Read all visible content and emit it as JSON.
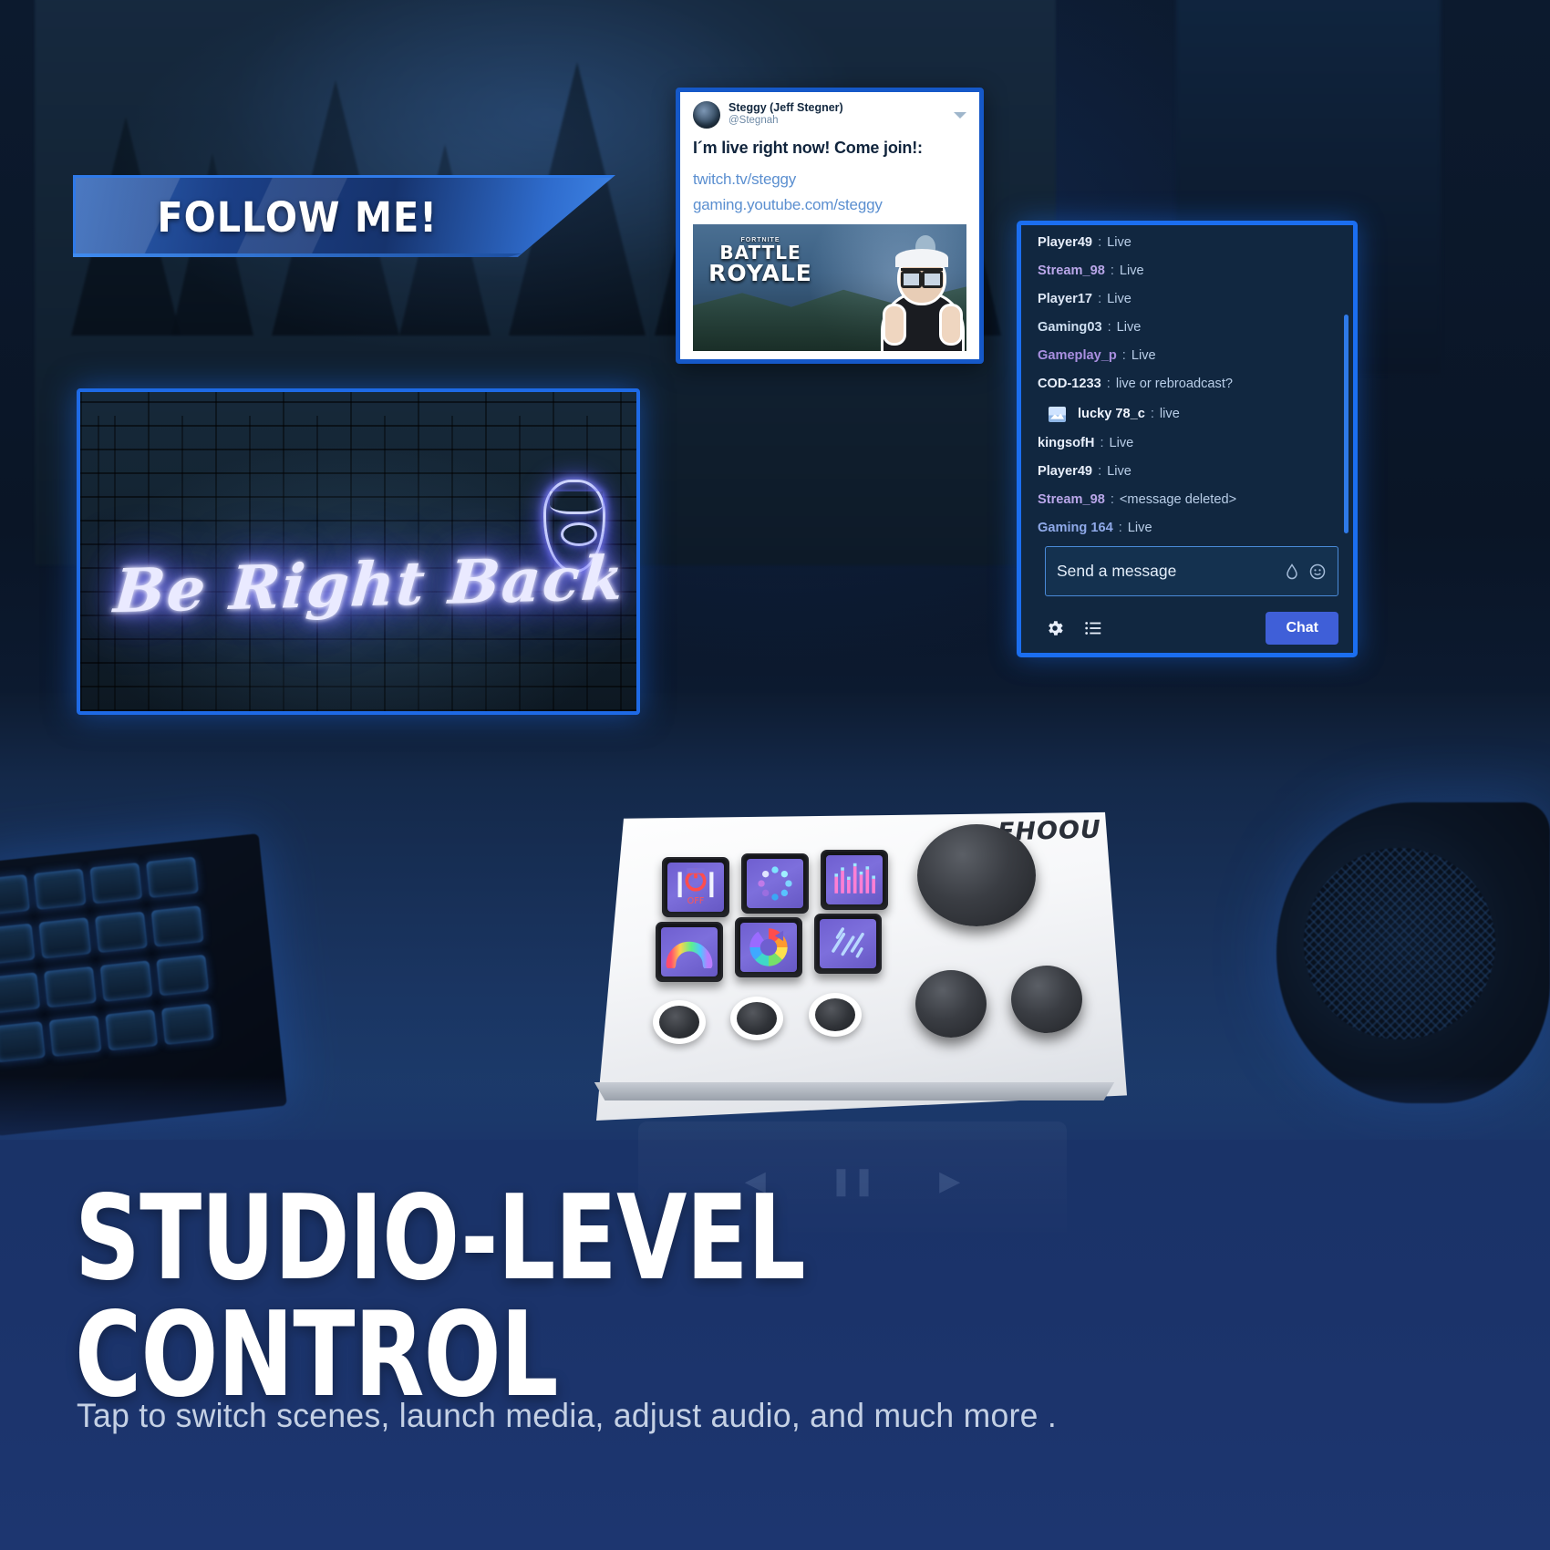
{
  "banner": {
    "follow_label": "FOLLOW ME!"
  },
  "brb": {
    "neon_text": "Be Right Back",
    "face_icon": "bearded-face-neon-icon"
  },
  "tweet": {
    "display_name": "Steggy (Jeff Stegner)",
    "handle": "@Stegnah",
    "body": "I´m live right now! Come join!:",
    "links": [
      "twitch.tv/steggy",
      "gaming.youtube.com/steggy"
    ],
    "chevron_icon": "chevron-down-icon",
    "avatar_icon": "avatar",
    "media": {
      "badge_top": "FORTNITE",
      "badge_line1": "BATTLE",
      "badge_line2": "ROYALE"
    }
  },
  "chat": {
    "messages": [
      {
        "user": "Player49",
        "text": "Live",
        "user_color": "#e7eefa",
        "thumb": false
      },
      {
        "user": "Stream_98",
        "text": "Live",
        "user_color": "#b9a6e8",
        "thumb": false
      },
      {
        "user": "Player17",
        "text": "Live",
        "user_color": "#dce6f5",
        "thumb": false
      },
      {
        "user": "Gaming03",
        "text": "Live",
        "user_color": "#cfe0f2",
        "thumb": false
      },
      {
        "user": "Gameplay_p",
        "text": "Live",
        "user_color": "#a98fe0",
        "thumb": false
      },
      {
        "user": "COD-1233",
        "text": "live or rebroadcast?",
        "user_color": "#e7eefa",
        "thumb": false
      },
      {
        "user": "lucky 78_c",
        "text": "live",
        "user_color": "#f0f5ff",
        "thumb": true
      },
      {
        "user": "kingsofH",
        "text": "Live",
        "user_color": "#e7eefa",
        "thumb": false
      },
      {
        "user": "Player49",
        "text": "Live",
        "user_color": "#e7eefa",
        "thumb": false
      },
      {
        "user": "Stream_98",
        "text": "<message deleted>",
        "user_color": "#b9a6e8",
        "thumb": false
      },
      {
        "user": "Gaming 164",
        "text": "Live",
        "user_color": "#8fa9e8",
        "thumb": false
      }
    ],
    "separator": ":",
    "input_placeholder": "Send a message",
    "input_value": "",
    "icons": {
      "bits": "bits-drop-icon",
      "emote": "emoji-smiley-icon",
      "settings": "gear-icon",
      "list": "chat-list-icon"
    },
    "send_label": "Chat",
    "accent_color": "#1b6ef0",
    "send_button_color": "#3f5fd8"
  },
  "device": {
    "brand": "FHOOU",
    "keys": [
      {
        "name": "power-off-key",
        "icon": "power-off-icon",
        "label": "OFF"
      },
      {
        "name": "loading-dots-key",
        "icon": "dot-ring-icon",
        "label": ""
      },
      {
        "name": "audio-mixer-key",
        "icon": "equalizer-icon",
        "label": ""
      },
      {
        "name": "brightness-arc-key",
        "icon": "rainbow-arc-icon",
        "label": ""
      },
      {
        "name": "color-wheel-key",
        "icon": "color-wheel-icon",
        "label": ""
      },
      {
        "name": "effects-key",
        "icon": "streaks-icon",
        "label": ""
      }
    ],
    "knobs": [
      "main-dial",
      "knob-left",
      "knob-right"
    ],
    "buttons": [
      "macro-button-1",
      "macro-button-2",
      "macro-button-3"
    ]
  },
  "footer": {
    "headline": "STUDIO-LEVEL CONTROL",
    "subtitle": "Tap to switch scenes, launch media, adjust audio, and much more .",
    "background_color": "#1a3368"
  },
  "reflection": {
    "prev_icon": "previous-track-icon",
    "play_icon": "play-icon",
    "next_icon": "next-track-icon"
  }
}
